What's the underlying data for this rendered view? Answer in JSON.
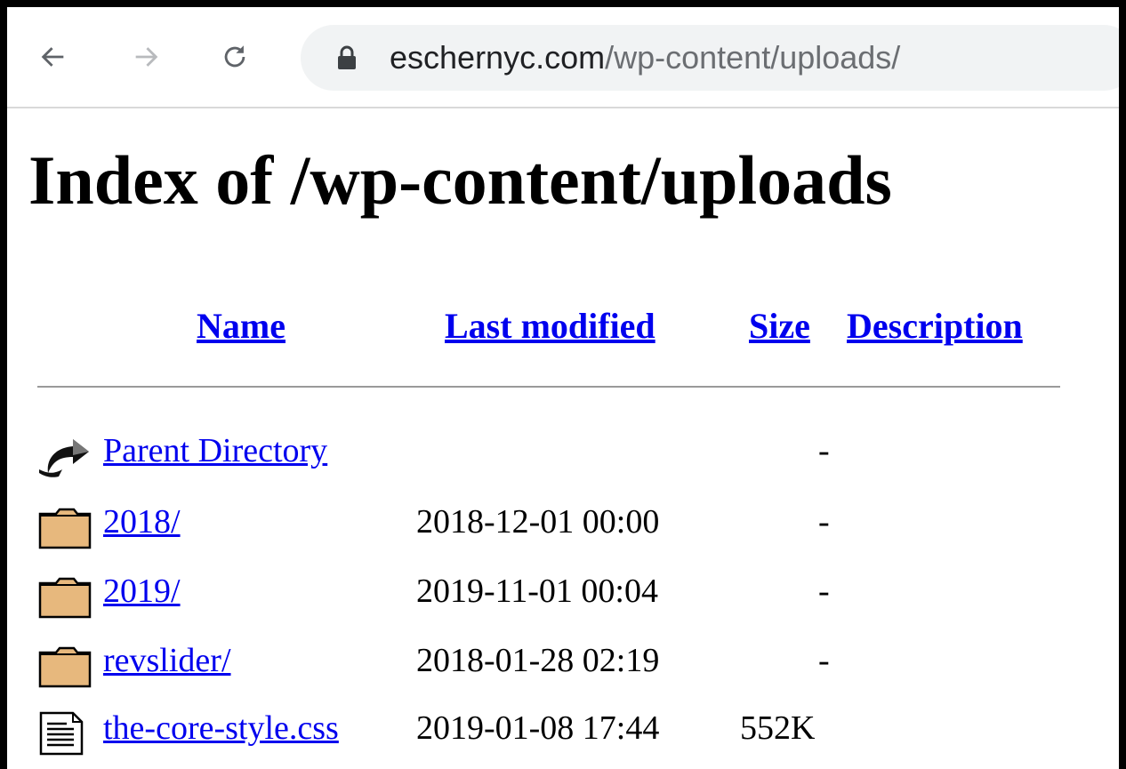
{
  "browser": {
    "url_host": "eschernyc.com",
    "url_path": "/wp-content/uploads/",
    "icons": {
      "back": "arrow-left-icon",
      "forward": "arrow-right-icon",
      "reload": "reload-icon",
      "lock": "lock-icon"
    }
  },
  "page": {
    "title": "Index of /wp-content/uploads",
    "columns": {
      "name": "Name",
      "last_modified": "Last modified",
      "size": "Size",
      "description": "Description"
    },
    "rows": [
      {
        "icon": "back-arrow-icon",
        "name": "Parent Directory",
        "modified": "",
        "size": "-",
        "description": ""
      },
      {
        "icon": "folder-icon",
        "name": "2018/",
        "modified": "2018-12-01 00:00",
        "size": "-",
        "description": ""
      },
      {
        "icon": "folder-icon",
        "name": "2019/",
        "modified": "2019-11-01 00:04",
        "size": "-",
        "description": ""
      },
      {
        "icon": "folder-icon",
        "name": "revslider/",
        "modified": "2018-01-28 02:19",
        "size": "-",
        "description": ""
      },
      {
        "icon": "text-file-icon",
        "name": "the-core-style.css",
        "modified": "2019-01-08 17:44",
        "size": "552K",
        "description": ""
      }
    ]
  },
  "colors": {
    "link": "#0000ee",
    "omnibox": "#f1f3f4",
    "frame": "#000000"
  }
}
